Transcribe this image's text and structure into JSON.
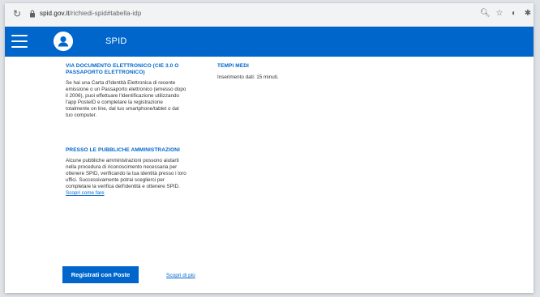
{
  "browser": {
    "url_host": "spid.gov.it",
    "url_path": "/richiedi-spid#tabella-idp"
  },
  "header": {
    "brand": "SPID"
  },
  "sections": {
    "cie": {
      "title": "VIA DOCUMENTO ELETTRONICO (CIE 3.0 O PASSAPORTO ELETTRONICO)",
      "body": "Se hai una Carta d'Identità Elettronica di recente emissione o un Passaporto elettronico (emesso dopo il 2006), puoi effettuare l'identificazione utilizzando l'app PosteID e completare la registrazione totalmente on line, dal tuo smartphone/tablet o dal tuo computer."
    },
    "pa": {
      "title": "PRESSO LE PUBBLICHE AMMINISTRAZIONI",
      "body": "Alcune pubbliche amministrazioni possono aiutarti nella procedura di riconoscimento necessaria per ottenere SPID, verificando la tua identità presso i loro uffici. Successivamente potrai sceglierci per completare la verifica dell'identità e ottenere SPID.",
      "link": "Scopri come fare"
    },
    "times": {
      "title": "TEMPI MEDI",
      "body": "Inserimento dati: 15 minuti."
    }
  },
  "actions": {
    "register": "Registrati con Poste",
    "more": "Scopri di più"
  },
  "colors": {
    "primary": "#0066cc"
  }
}
